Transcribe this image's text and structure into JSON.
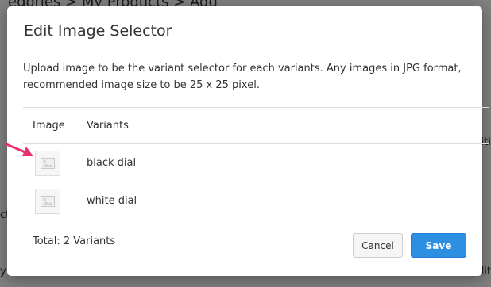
{
  "background": {
    "breadcrumb": "egories > My Products > Add",
    "fragment_right_1": "iti",
    "fragment_left_1": "ct",
    "fragment_left_2": "y",
    "fragment_right_2": "dit"
  },
  "modal": {
    "title": "Edit Image Selector",
    "description": "Upload image to be the variant selector for each variants. Any images in JPG format, recommended image size to be 25 x 25 pixel.",
    "table": {
      "headers": {
        "image": "Image",
        "variants": "Variants"
      },
      "rows": [
        {
          "variant": "black dial",
          "image_icon": "image-placeholder-icon"
        },
        {
          "variant": "white dial",
          "image_icon": "image-placeholder-icon"
        }
      ]
    },
    "footer": {
      "total": "Total: 2 Variants",
      "cancel_label": "Cancel",
      "save_label": "Save"
    }
  },
  "colors": {
    "primary_button": "#2d8fe2",
    "annotation_arrow": "#e8336e"
  }
}
